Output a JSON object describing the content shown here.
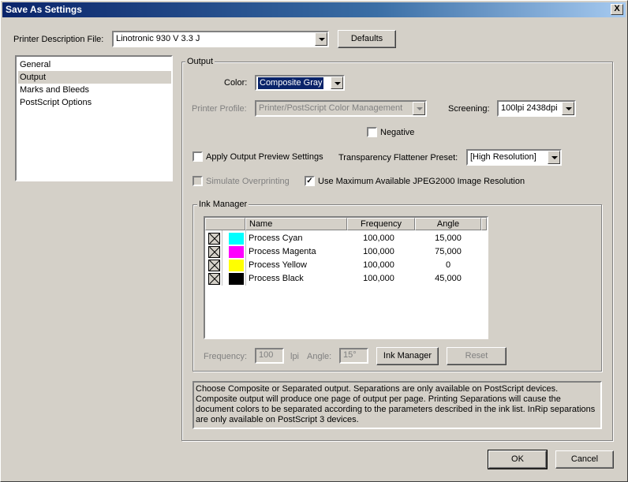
{
  "window": {
    "title": "Save As Settings",
    "close_glyph": "X"
  },
  "printer": {
    "label": "Printer Description File:",
    "value": "Linotronic 930 V 3.3 J",
    "defaults_label": "Defaults"
  },
  "categories": {
    "items": [
      {
        "label": "General",
        "selected": false
      },
      {
        "label": "Output",
        "selected": true
      },
      {
        "label": "Marks and Bleeds",
        "selected": false
      },
      {
        "label": "PostScript Options",
        "selected": false
      }
    ]
  },
  "output": {
    "group_title": "Output",
    "color_label": "Color:",
    "color_value": "Composite Gray",
    "profile_label": "Printer Profile:",
    "profile_value": "Printer/PostScript Color Management",
    "screening_label": "Screening:",
    "screening_value": "100lpi 2438dpi",
    "negative_label": "Negative",
    "negative_checked": false,
    "apply_preview_label": "Apply Output Preview Settings",
    "apply_preview_checked": false,
    "flattener_label": "Transparency Flattener Preset:",
    "flattener_value": "[High Resolution]",
    "simulate_overprint_label": "Simulate Overprinting",
    "simulate_overprint_checked": false,
    "jpeg2000_label": "Use Maximum Available JPEG2000 Image Resolution",
    "jpeg2000_checked": true
  },
  "ink_manager": {
    "group_title": "Ink Manager",
    "columns": {
      "name": "Name",
      "frequency": "Frequency",
      "angle": "Angle"
    },
    "rows": [
      {
        "name": "Process Cyan",
        "color": "#00ffff",
        "frequency": "100,000",
        "angle": "15,000"
      },
      {
        "name": "Process Magenta",
        "color": "#ff00ff",
        "frequency": "100,000",
        "angle": "75,000"
      },
      {
        "name": "Process Yellow",
        "color": "#ffff00",
        "frequency": "100,000",
        "angle": "0"
      },
      {
        "name": "Process Black",
        "color": "#000000",
        "frequency": "100,000",
        "angle": "45,000"
      }
    ],
    "frequency_label": "Frequency:",
    "frequency_value": "100",
    "lpi_label": "lpi",
    "angle_label": "Angle:",
    "angle_value": "15°",
    "ink_manager_button": "Ink Manager",
    "reset_button": "Reset"
  },
  "description": "Choose Composite or Separated output. Separations are only available on PostScript devices. Composite output will produce one page of output per page. Printing Separations will cause the document colors to be separated according to the parameters described in the ink list. InRip separations are only available on PostScript 3 devices.",
  "buttons": {
    "ok": "OK",
    "cancel": "Cancel"
  }
}
